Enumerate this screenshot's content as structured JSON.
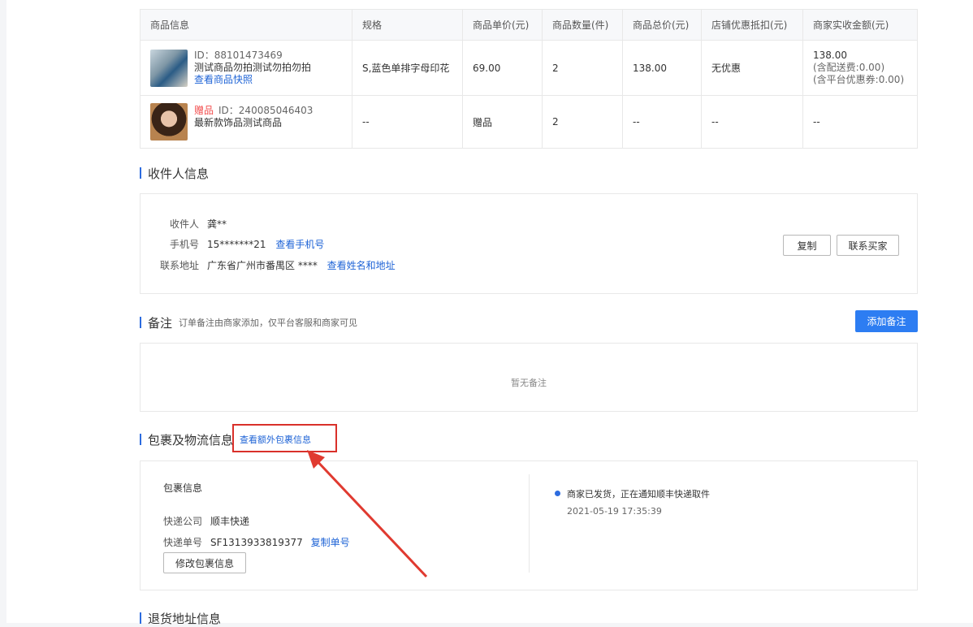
{
  "products_table": {
    "headers": [
      "商品信息",
      "规格",
      "商品单价(元)",
      "商品数量(件)",
      "商品总价(元)",
      "店铺优惠抵扣(元)",
      "商家实收金额(元)"
    ],
    "rows": [
      {
        "id": "ID：88101473469",
        "name": "测试商品勿拍测试勿拍勿拍",
        "link": "查看商品快照",
        "spec": "S,蓝色单排字母印花",
        "unit_price": "69.00",
        "qty": "2",
        "total": "138.00",
        "discount": "无优惠",
        "received": "138.00",
        "received_note1": "(含配送费:0.00)",
        "received_note2": "(含平台优惠券:0.00)"
      },
      {
        "gift_tag": "赠品",
        "id": "ID：240085046403",
        "name": "最新款饰品测试商品",
        "spec": "--",
        "unit_price": "赠品",
        "qty": "2",
        "total": "--",
        "discount": "--",
        "received": "--"
      }
    ]
  },
  "recipient": {
    "title": "收件人信息",
    "name_label": "收件人",
    "name_value": "龚**",
    "phone_label": "手机号",
    "phone_value": "15*******21",
    "phone_link": "查看手机号",
    "address_label": "联系地址",
    "address_value": "广东省广州市番禺区 ****",
    "address_link": "查看姓名和地址",
    "copy_button": "复制",
    "contact_button": "联系买家"
  },
  "remarks": {
    "title": "备注",
    "subtitle": "订单备注由商家添加，仅平台客服和商家可见",
    "add_button": "添加备注",
    "empty_text": "暂无备注"
  },
  "logistics": {
    "title": "包裹及物流信息",
    "extra_link": "查看额外包裹信息",
    "package_title": "包裹信息",
    "company_label": "快递公司",
    "company_value": "顺丰快递",
    "tracking_label": "快递单号",
    "tracking_value": "SF1313933819377",
    "copy_link": "复制单号",
    "modify_button": "修改包裹信息",
    "status_text": "商家已发货，正在通知顺丰快递取件",
    "status_time": "2021-05-19 17:35:39"
  },
  "return_address": {
    "title": "退货地址信息"
  },
  "colors": {
    "accent": "#2d6cdf",
    "link": "#1e63d6",
    "gift": "#f24c4c",
    "highlight": "#d9302a"
  }
}
